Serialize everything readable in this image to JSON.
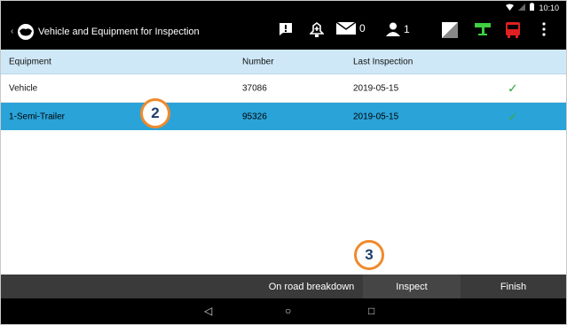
{
  "status_bar": {
    "time": "10:10"
  },
  "app_bar": {
    "title": "Vehicle and Equipment for Inspection",
    "mail_count": "0",
    "person_count": "1"
  },
  "table": {
    "headers": [
      "Equipment",
      "Number",
      "Last Inspection"
    ],
    "rows": [
      {
        "equipment": "Vehicle",
        "number": "37086",
        "last_inspection": "2019-05-15",
        "status": "✓"
      },
      {
        "equipment": "1-Semi-Trailer",
        "number": "95326",
        "last_inspection": "2019-05-15",
        "status": "✓"
      }
    ]
  },
  "callouts": {
    "first": "2",
    "second": "3"
  },
  "bottom_bar": {
    "breakdown_label": "On road breakdown",
    "inspect_label": "Inspect",
    "finish_label": "Finish"
  },
  "nav": {
    "back": "◁",
    "home": "○",
    "recents": "□"
  },
  "colors": {
    "selected_row": "#2aa3d9",
    "header_row": "#cfe8f7",
    "check": "#3aa849",
    "callout_ring": "#f08a2c"
  }
}
